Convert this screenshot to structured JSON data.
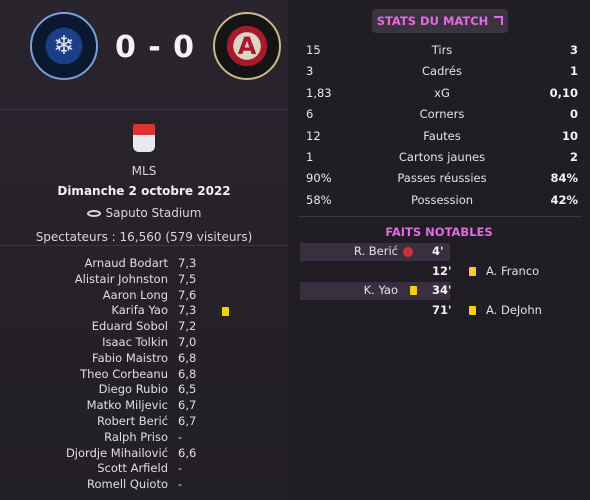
{
  "score": "0 - 0",
  "stats_header": {
    "title": "STATS DU MATCH"
  },
  "match": {
    "competition": "MLS",
    "date": "Dimanche 2 octobre 2022",
    "venue": "Saputo Stadium",
    "attendance": "Spectateurs : 16,560 (579 visiteurs)"
  },
  "ratings": [
    {
      "name": "Arnaud Bodart",
      "rating": "7,3",
      "yellow": false
    },
    {
      "name": "Alistair Johnston",
      "rating": "7,5",
      "yellow": false
    },
    {
      "name": "Aaron Long",
      "rating": "7,6",
      "yellow": false
    },
    {
      "name": "Karifa Yao",
      "rating": "7,3",
      "yellow": true
    },
    {
      "name": "Eduard Sobol",
      "rating": "7,2",
      "yellow": false
    },
    {
      "name": "Isaac Tolkin",
      "rating": "7,0",
      "yellow": false
    },
    {
      "name": "Fabio Maistro",
      "rating": "6,8",
      "yellow": false
    },
    {
      "name": "Theo Corbeanu",
      "rating": "6,8",
      "yellow": false
    },
    {
      "name": "Diego Rubio",
      "rating": "6,5",
      "yellow": false
    },
    {
      "name": "Matko Miljevic",
      "rating": "6,7",
      "yellow": false
    },
    {
      "name": "Robert Berić",
      "rating": "6,7",
      "yellow": false
    },
    {
      "name": "Ralph Priso",
      "rating": "-",
      "yellow": false
    },
    {
      "name": "Djordje Mihailović",
      "rating": "6,6",
      "yellow": false
    },
    {
      "name": "Scott Arfield",
      "rating": "-",
      "yellow": false
    },
    {
      "name": "Romell Quioto",
      "rating": "-",
      "yellow": false
    }
  ],
  "stats": [
    {
      "label": "Tirs",
      "home": "15",
      "away": "3"
    },
    {
      "label": "Cadrés",
      "home": "3",
      "away": "1"
    },
    {
      "label": "xG",
      "home": "1,83",
      "away": "0,10"
    },
    {
      "label": "Corners",
      "home": "6",
      "away": "0"
    },
    {
      "label": "Fautes",
      "home": "12",
      "away": "10"
    },
    {
      "label": "Cartons jaunes",
      "home": "1",
      "away": "2"
    },
    {
      "label": "Passes réussies",
      "home": "90%",
      "away": "84%"
    },
    {
      "label": "Possession",
      "home": "58%",
      "away": "42%"
    }
  ],
  "facts": {
    "title": "FAITS NOTABLES",
    "events": [
      {
        "minute": "4'",
        "side": "home",
        "player": "R. Berić",
        "type": "chance-icon"
      },
      {
        "minute": "12'",
        "side": "away",
        "player": "A. Franco",
        "type": "yellow-card-icon"
      },
      {
        "minute": "34'",
        "side": "home",
        "player": "K. Yao",
        "type": "yellow-card-icon"
      },
      {
        "minute": "71'",
        "side": "away",
        "player": "A. DeJohn",
        "type": "yellow-card-icon"
      }
    ]
  },
  "colors": {
    "accent": "#e46be0",
    "yellow_card": "#f2d20f",
    "background": "#27222a"
  }
}
